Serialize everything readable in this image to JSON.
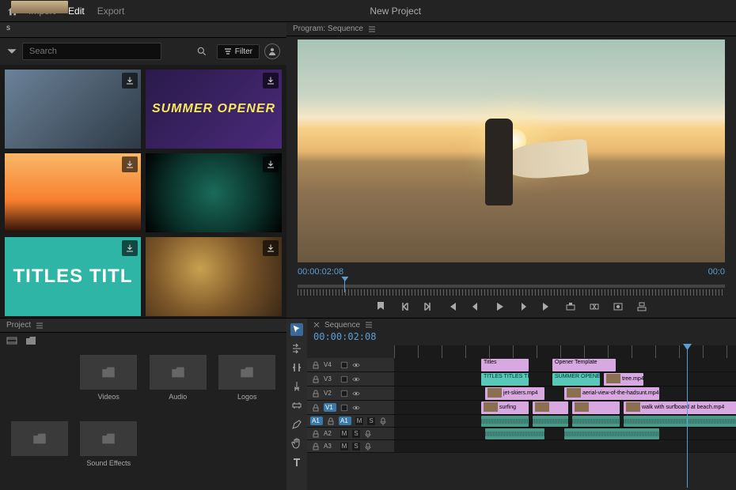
{
  "topbar": {
    "tabs": {
      "import": "Import",
      "edit": "Edit",
      "export": "Export"
    },
    "title": "New Project"
  },
  "stock": {
    "panel_label": "s",
    "search_placeholder": "Search",
    "filter_label": "Filter",
    "items": {
      "summer_opener": "SUMMER OPENER",
      "titles": "TITLES  TITL"
    }
  },
  "program": {
    "panel_label": "Program: Sequence",
    "timecode_left": "00:00:02:08",
    "timecode_right": "00:0"
  },
  "project": {
    "panel_label": "Project",
    "bins": {
      "videos": "Videos",
      "audio": "Audio",
      "logos": "Logos",
      "sound_effects": "Sound Effects"
    }
  },
  "timeline": {
    "panel_label": "Sequence",
    "timecode": "00:00:02:08",
    "tracks": {
      "v4": "V4",
      "v3": "V3",
      "v2": "V2",
      "v1": "V1",
      "a1": "A1",
      "a2": "A2",
      "a3": "A3"
    },
    "track_label_a1": "A1",
    "clips": {
      "titles": "Titles",
      "titles_tile": "TITLES TITLES TITLE",
      "opener_template": "Opener Template",
      "summer_opener": "SUMMER OPENER",
      "tree_mp4": "tree.mp4",
      "jet_skiers": "jet-skiers.mp4",
      "aerial_hadsunt": "aerial-view-of-the-hadsunt.mp4",
      "surfing": "surfing",
      "walk_surfboard": "walk with surfboard at beach.mp4"
    }
  }
}
